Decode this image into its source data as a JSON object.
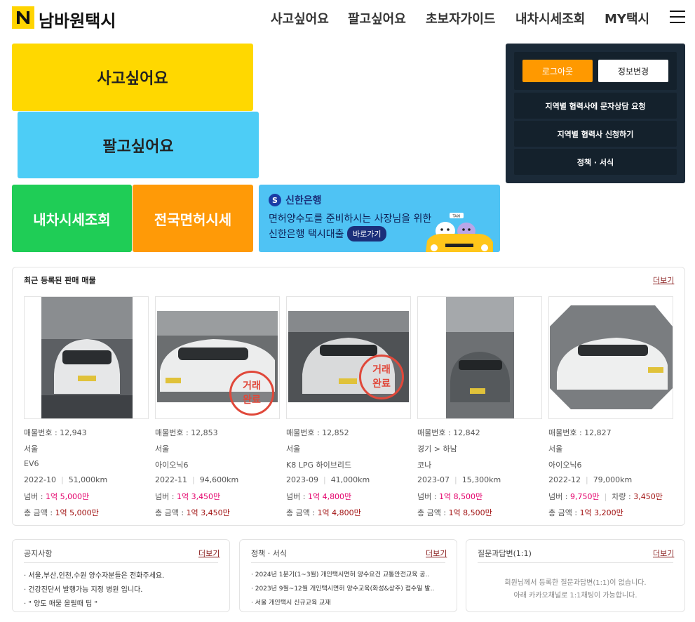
{
  "header": {
    "logo_text": "남바원택시",
    "nav": [
      "사고싶어요",
      "팔고싶어요",
      "초보자가이드",
      "내차시세조회",
      "MY택시"
    ]
  },
  "tiles": {
    "buy": "사고싶어요",
    "sell": "팔고싶어요",
    "quote": "내차시세조회",
    "license": "전국면허시세"
  },
  "banner": {
    "bank": "신한은행",
    "line1": "면허양수도를 준비하시는 사장님을 위한",
    "line2": "신한은행 택시대출",
    "button": "바로가기",
    "taxi_sign": "TAXI"
  },
  "account": {
    "logout": "로그아웃",
    "edit_info": "정보변경",
    "items": [
      "지역별 협력사에 문자상담 요청",
      "지역별 협력사 신청하기",
      "정책 · 서식"
    ]
  },
  "listings": {
    "title": "최근 등록된 판매 매물",
    "more": "더보기",
    "cards": [
      {
        "number": "매물번호 : 12,943",
        "region": "서울",
        "model": "EV6",
        "year": "2022-10",
        "mileage": "51,000km",
        "license_label": "넘버 : ",
        "license_price": "1억 5,000만",
        "extra_label": "",
        "extra_value": "",
        "total_label": "총 금액 : ",
        "total_price": "1억 5,000만",
        "stamp": false
      },
      {
        "number": "매물번호 : 12,853",
        "region": "서울",
        "model": "아이오닉6",
        "year": "2022-11",
        "mileage": "94,600km",
        "license_label": "넘버 : ",
        "license_price": "1억 3,450만",
        "extra_label": "",
        "extra_value": "",
        "total_label": "총 금액 : ",
        "total_price": "1억 3,450만",
        "stamp": true
      },
      {
        "number": "매물번호 : 12,852",
        "region": "서울",
        "model": "K8 LPG 하이브리드",
        "year": "2023-09",
        "mileage": "41,000km",
        "license_label": "넘버 : ",
        "license_price": "1억 4,800만",
        "extra_label": "",
        "extra_value": "",
        "total_label": "총 금액 : ",
        "total_price": "1억 4,800만",
        "stamp": true
      },
      {
        "number": "매물번호 : 12,842",
        "region": "경기 > 하남",
        "model": "코나",
        "year": "2023-07",
        "mileage": "15,300km",
        "license_label": "넘버 : ",
        "license_price": "1억 8,500만",
        "extra_label": "",
        "extra_value": "",
        "total_label": "총 금액 : ",
        "total_price": "1억 8,500만",
        "stamp": false
      },
      {
        "number": "매물번호 : 12,827",
        "region": "서울",
        "model": "아이오닉6",
        "year": "2022-12",
        "mileage": "79,000km",
        "license_label": "넘버 : ",
        "license_price": "9,750만",
        "extra_label": "차량 : ",
        "extra_value": "3,450만",
        "total_label": "총 금액 : ",
        "total_price": "1억 3,200만",
        "stamp": false
      }
    ],
    "stamp_line1": "거래",
    "stamp_line2": "완료"
  },
  "notice": {
    "title": "공지사항",
    "more": "더보기",
    "items": [
      "· 서울,부산,인천,수원 양수자분들은 전화주세요.",
      "· 건강진단서 발행가능 지정 병원 입니다.",
      "· \" 양도 매물 올릴때 팁 \""
    ]
  },
  "policy": {
    "title": "정책 · 서식",
    "more": "더보기",
    "items": [
      "· 2024년 1분기(1~3월) 개인택시면허 양수요건 교통안전교육 공..",
      "· 2023년 9월~12월 개인택시면허 양수교육(화성&상주) 접수일 발..",
      "· 서울 개인택시 신규교육 교재"
    ]
  },
  "qna": {
    "title": "질문과답변(1:1)",
    "more": "더보기",
    "empty1": "회원님께서 등록한 질문과답변(1:1)이 없습니다.",
    "empty2": "아래 카카오채널로 1:1채팅이 가능합니다."
  },
  "colors": {
    "brand_yellow": "#FFD800",
    "sky": "#4DCDF6",
    "green": "#1FCD56",
    "orange": "#FF9A07",
    "navy": "#1B2A38",
    "price_red": "#e4006b"
  }
}
